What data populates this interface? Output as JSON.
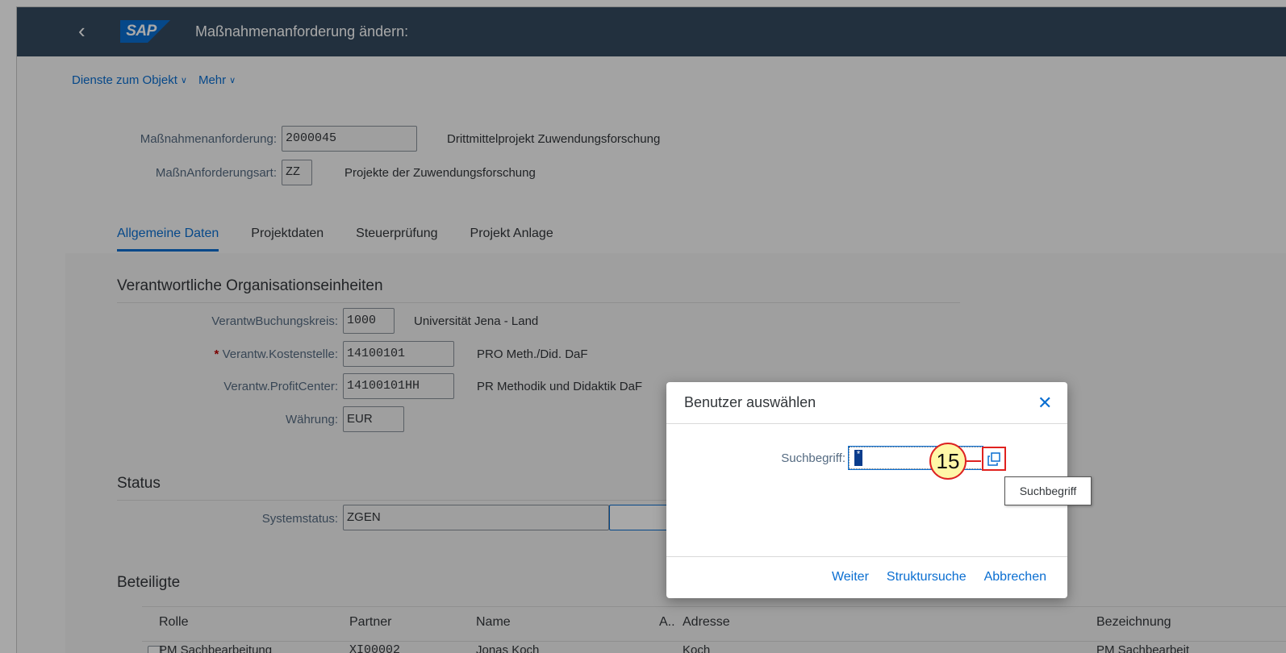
{
  "shell": {
    "back_glyph": "‹",
    "logo": "SAP",
    "title": "Maßnahmenanforderung ändern:"
  },
  "toolbar": {
    "items": [
      {
        "label": "Dienste zum Objekt",
        "chevron": "∨"
      },
      {
        "label": "Mehr",
        "chevron": "∨"
      }
    ]
  },
  "header": {
    "request_label": "Maßnahmenanforderung:",
    "request_value": "2000045",
    "request_desc": "Drittmittelprojekt Zuwendungsforschung",
    "type_label": "MaßnAnforderungsart:",
    "type_value": "ZZ",
    "type_desc": "Projekte der Zuwendungsforschung"
  },
  "tabs": [
    {
      "label": "Allgemeine Daten",
      "active": true
    },
    {
      "label": "Projektdaten",
      "active": false
    },
    {
      "label": "Steuerprüfung",
      "active": false
    },
    {
      "label": "Projekt Anlage",
      "active": false
    }
  ],
  "org": {
    "title": "Verantwortliche Organisationseinheiten",
    "company_code_label": "VerantwBuchungskreis:",
    "company_code_value": "1000",
    "company_code_desc": "Universität Jena - Land",
    "required_mark": "*",
    "cost_center_label": "Verantw.Kostenstelle:",
    "cost_center_value": "14100101",
    "cost_center_desc": "PRO Meth./Did. DaF",
    "profit_center_label": "Verantw.ProfitCenter:",
    "profit_center_value": "14100101HH",
    "profit_center_desc": "PR Methodik und Didaktik DaF",
    "currency_label": "Währung:",
    "currency_value": "EUR"
  },
  "status": {
    "title": "Status",
    "system_status_label": "Systemstatus:",
    "system_status_value": "ZGEN"
  },
  "participants": {
    "title": "Beteiligte",
    "columns": [
      "Rolle",
      "Partner",
      "Name",
      "A..",
      "Adresse",
      "Bezeichnung"
    ],
    "rows": [
      {
        "Rolle": "PM Sachbearbeitung",
        "Partner": "XI00002",
        "Name": "Jonas Koch",
        "A": "",
        "Adresse": "Koch",
        "Bezeichnung": "PM Sachbearbeit"
      }
    ]
  },
  "dialog": {
    "title": "Benutzer auswählen",
    "close_glyph": "✕",
    "search_label": "Suchbegriff:",
    "search_value": "*",
    "step_number": "15",
    "buttons": {
      "next": "Weiter",
      "structure": "Struktursuche",
      "cancel": "Abbrechen"
    }
  },
  "tooltip": {
    "text": "Suchbegriff"
  },
  "colors": {
    "shell": "#354a5f",
    "accent": "#0a6ed1",
    "highlight_border": "#e0221f",
    "badge_fill": "#fff7a8"
  }
}
